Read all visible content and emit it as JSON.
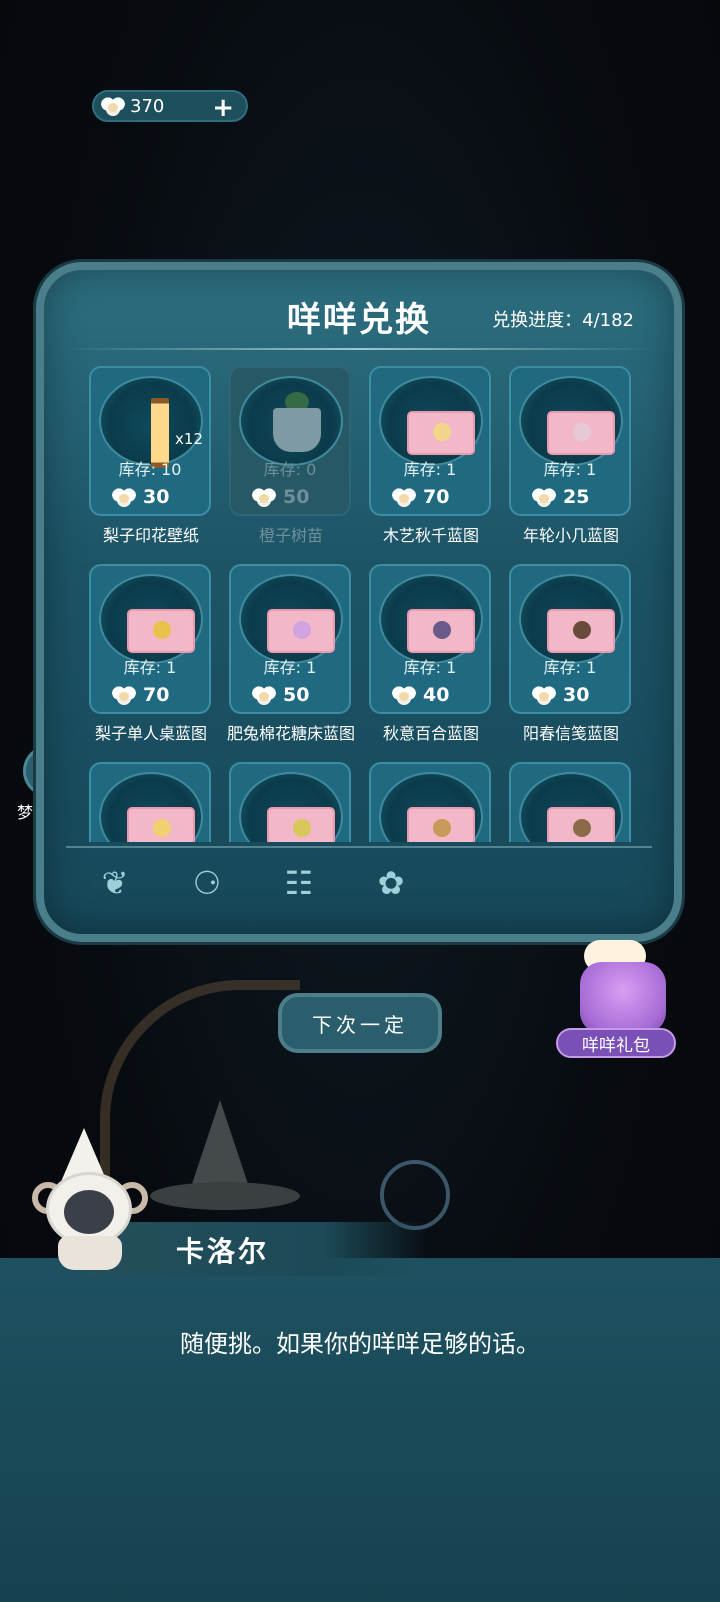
{
  "currency": {
    "amount": "370",
    "add_label": "+"
  },
  "side": {
    "dream_preview_label": "梦境预览"
  },
  "panel": {
    "title": "咩咩兑换",
    "progress": "兑换进度：4/182",
    "items": [
      {
        "name": "梨子印花壁纸",
        "stock": "库存: 10",
        "price": "30",
        "qty": "x12",
        "kind": "wallpaper",
        "disabled": false
      },
      {
        "name": "橙子树苗",
        "stock": "库存: 0",
        "price": "50",
        "kind": "sapling",
        "disabled": true
      },
      {
        "name": "木艺秋千蓝图",
        "stock": "库存: 1",
        "price": "70",
        "kind": "blueprint",
        "disabled": false
      },
      {
        "name": "年轮小几蓝图",
        "stock": "库存: 1",
        "price": "25",
        "kind": "blueprint",
        "disabled": false
      },
      {
        "name": "梨子单人桌蓝图",
        "stock": "库存: 1",
        "price": "70",
        "kind": "blueprint",
        "disabled": false
      },
      {
        "name": "肥兔棉花糖床蓝图",
        "stock": "库存: 1",
        "price": "50",
        "kind": "blueprint",
        "disabled": false
      },
      {
        "name": "秋意百合蓝图",
        "stock": "库存: 1",
        "price": "40",
        "kind": "blueprint",
        "disabled": false
      },
      {
        "name": "阳春信笺蓝图",
        "stock": "库存: 1",
        "price": "30",
        "kind": "blueprint",
        "disabled": false
      },
      {
        "name": "",
        "stock": "",
        "price": "",
        "kind": "blueprint",
        "disabled": false
      },
      {
        "name": "",
        "stock": "",
        "price": "",
        "kind": "blueprint",
        "disabled": false
      },
      {
        "name": "",
        "stock": "",
        "price": "",
        "kind": "blueprint",
        "disabled": false
      },
      {
        "name": "",
        "stock": "",
        "price": "",
        "kind": "blueprint",
        "disabled": false
      }
    ],
    "tabs": [
      {
        "icon": "sprout-icon",
        "glyph": "❦"
      },
      {
        "icon": "furniture-icon",
        "glyph": "⚆"
      },
      {
        "icon": "blueprint-icon",
        "glyph": "☷"
      },
      {
        "icon": "flower-icon",
        "glyph": "✿"
      }
    ]
  },
  "gift": {
    "label": "咩咩礼包"
  },
  "next_button": {
    "label": "下次一定"
  },
  "dialog": {
    "speaker": "卡洛尔",
    "text": "随便挑。如果你的咩咩足够的话。"
  },
  "colors": {
    "panel": "#1c5466",
    "dialog": "#1e5160",
    "accent": "#4a7e8a"
  }
}
